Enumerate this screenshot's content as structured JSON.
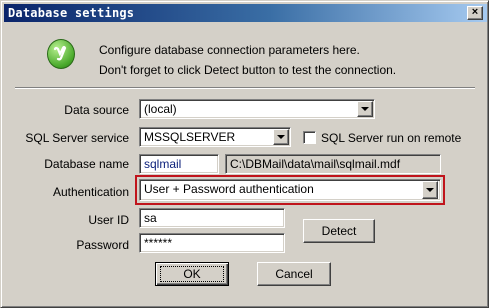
{
  "window": {
    "title": "Database settings",
    "close_glyph": "×"
  },
  "info": {
    "icon": "green-info-icon",
    "line1": "Configure database connection parameters here.",
    "line2": "Don't forget to click Detect button to test the connection."
  },
  "form": {
    "data_source": {
      "label": "Data source",
      "value": "(local)"
    },
    "sql_service": {
      "label": "SQL Server service",
      "value": "MSSQLSERVER"
    },
    "remote_checkbox": {
      "label": "SQL Server run on remote",
      "checked": false
    },
    "database_name": {
      "label": "Database name",
      "value": "sqlmail",
      "path": "C:\\DBMail\\data\\mail\\sqlmail.mdf"
    },
    "authentication": {
      "label": "Authentication",
      "value": "User + Password authentication"
    },
    "user_id": {
      "label": "User ID",
      "value": "sa"
    },
    "password": {
      "label": "Password",
      "value": "******"
    }
  },
  "buttons": {
    "detect": "Detect",
    "ok": "OK",
    "cancel": "Cancel"
  },
  "colors": {
    "title_gradient_start": "#0a246a",
    "title_gradient_end": "#a6caf0",
    "highlight_border": "#c0141c"
  }
}
